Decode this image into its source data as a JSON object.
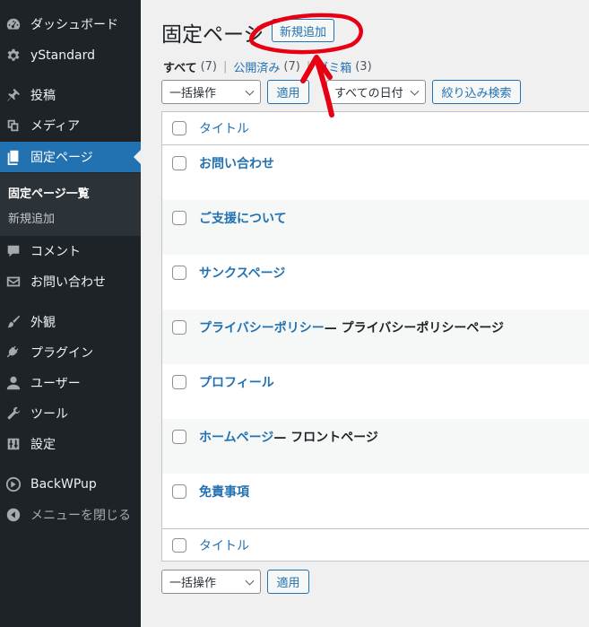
{
  "sidebar": {
    "items": [
      {
        "label": "ダッシュボード",
        "icon": "dashboard-icon"
      },
      {
        "label": "yStandard",
        "icon": "gear-icon"
      },
      {
        "label": "投稿",
        "icon": "pin-icon"
      },
      {
        "label": "メディア",
        "icon": "media-icon"
      },
      {
        "label": "固定ページ",
        "icon": "pages-icon"
      },
      {
        "label": "コメント",
        "icon": "comment-icon"
      },
      {
        "label": "お問い合わせ",
        "icon": "mail-icon"
      },
      {
        "label": "外観",
        "icon": "brush-icon"
      },
      {
        "label": "プラグイン",
        "icon": "plugin-icon"
      },
      {
        "label": "ユーザー",
        "icon": "user-icon"
      },
      {
        "label": "ツール",
        "icon": "wrench-icon"
      },
      {
        "label": "設定",
        "icon": "settings-icon"
      },
      {
        "label": "BackWPup",
        "icon": "backwpup-icon"
      },
      {
        "label": "メニューを閉じる",
        "icon": "collapse-icon"
      }
    ],
    "submenu": [
      "固定ページ一覧",
      "新規追加"
    ]
  },
  "header": {
    "title": "固定ページ",
    "add_new": "新規追加"
  },
  "views": [
    {
      "label": "すべて",
      "count": "(7)"
    },
    {
      "label": "公開済み",
      "count": "(7)"
    },
    {
      "label": "ゴミ箱",
      "count": "(3)"
    }
  ],
  "filters": {
    "bulk_action": "一括操作",
    "apply": "適用",
    "dates": "すべての日付",
    "filter": "絞り込み検索"
  },
  "table": {
    "column_title": "タイトル",
    "rows": [
      {
        "title": "お問い合わせ",
        "state": ""
      },
      {
        "title": "ご支援について",
        "state": ""
      },
      {
        "title": "サンクスページ",
        "state": ""
      },
      {
        "title": "プライバシーポリシー",
        "state": " — プライバシーポリシーページ"
      },
      {
        "title": "プロフィール",
        "state": ""
      },
      {
        "title": "ホームページ",
        "state": " — フロントページ"
      },
      {
        "title": "免責事項",
        "state": ""
      }
    ]
  },
  "colors": {
    "sidebar_bg": "#1d2327",
    "accent": "#2271b1",
    "annotation": "#e60012"
  }
}
